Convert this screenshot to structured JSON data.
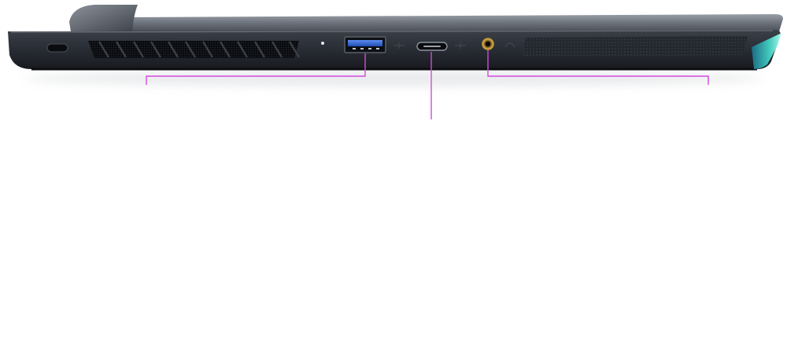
{
  "product": {
    "view": "laptop-left-side-profile",
    "ports": [
      {
        "id": "kensington-lock",
        "icon": "lock-slot-icon"
      },
      {
        "id": "usb-a",
        "icon": "usb-a-port-icon"
      },
      {
        "id": "usb-c",
        "icon": "usb-c-port-icon"
      },
      {
        "id": "audio-jack",
        "icon": "audio-jack-icon"
      }
    ],
    "callouts": [
      {
        "id": "callout-vent-usb-a",
        "target": "usb-a"
      },
      {
        "id": "callout-usb-c",
        "target": "usb-c"
      },
      {
        "id": "callout-audio-speaker",
        "target": "audio-jack"
      }
    ]
  },
  "colors": {
    "background": "#ffffff",
    "chassis_top": "#6b7079",
    "chassis_body": "#2a2e36",
    "chassis_dark": "#15171c",
    "usb_a_blue": "#2f62c9",
    "audio_gold": "#c59a3a",
    "rgb_glow": "#43d3c4",
    "callout_magenta": "#d24ae0"
  }
}
